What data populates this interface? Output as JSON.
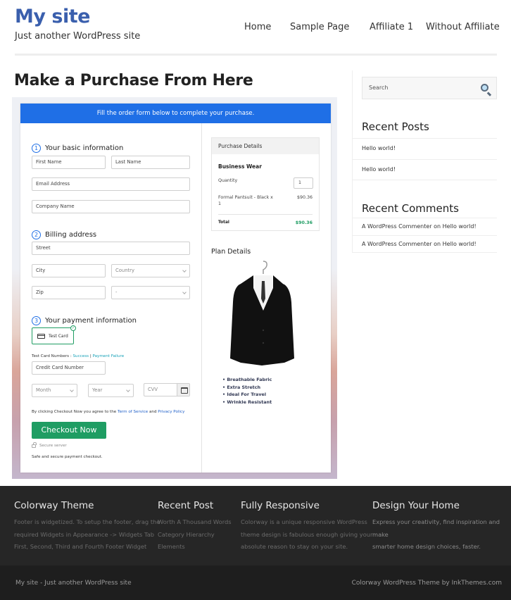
{
  "header": {
    "site_title": "My site",
    "tagline": "Just another WordPress site",
    "nav": [
      "Home",
      "Sample Page",
      "Affiliate 1",
      "Without Affiliate"
    ]
  },
  "page": {
    "title": "Make a Purchase From Here"
  },
  "checkout": {
    "banner": "Fill the order form below to complete your purchase.",
    "steps": [
      {
        "num": "1",
        "label": "Your basic information"
      },
      {
        "num": "2",
        "label": "Billing address"
      },
      {
        "num": "3",
        "label": "Your payment information"
      }
    ],
    "fields": {
      "first_name": "First Name",
      "last_name": "Last Name",
      "email": "Email Address",
      "company": "Company Name",
      "street": "Street",
      "city": "City",
      "country": "Country",
      "zip": "Zip",
      "state": "-",
      "card_number": "Credit Card Number",
      "month": "Month",
      "year": "Year",
      "cvv": "CVV"
    },
    "payment_option": "Test Card",
    "test_card_label": "Test Card Numbers :",
    "test_success": "Success",
    "test_separator": "|",
    "test_failure": "Payment Failure",
    "agree_prefix": "By clicking Checkout Now you agree to the",
    "terms_link": "Term of Service",
    "agree_and": "and",
    "privacy_link": "Privacy Policy",
    "checkout_button": "Checkout Now",
    "secure_server": "Secure server",
    "safe_text": "Safe and secure payment checkout.",
    "purchase": {
      "heading": "Purchase Details",
      "product": "Business Wear",
      "quantity_label": "Quantity",
      "quantity_value": "1",
      "line_item": "Formal Pantsuit - Black x",
      "line_item_qty": "1",
      "line_price": "$90.36",
      "total_label": "Total",
      "total_value": "$90.36",
      "total_color": "#1f9d63"
    },
    "plan": {
      "title": "Plan Details",
      "features": [
        "Breathable Fabric",
        "Extra Stretch",
        "Ideal For Travel",
        "Wrinkle Resistant"
      ]
    }
  },
  "sidebar": {
    "search_placeholder": "Search",
    "recent_posts_title": "Recent Posts",
    "recent_posts": [
      "Hello world!",
      "Hello world!"
    ],
    "recent_comments_title": "Recent Comments",
    "recent_comments": [
      "A WordPress Commenter on Hello world!",
      "A WordPress Commenter on Hello world!"
    ]
  },
  "footer": {
    "columns": [
      {
        "title": "Colorway Theme",
        "lines": [
          "Footer is widgetized. To setup the footer, drag the",
          "required Widgets in Appearance -> Widgets Tab",
          "First, Second, Third and Fourth Footer Widget"
        ]
      },
      {
        "title": "Recent Post",
        "lines": [
          "Worth A Thousand Words",
          "Category Hierarchy",
          "Elements"
        ]
      },
      {
        "title": "Fully Responsive",
        "lines": [
          "Colorway is a unique responsive WordPress",
          "theme design is fabulous enough giving your",
          "absolute reason to stay on your site."
        ]
      },
      {
        "title": "Design Your Home",
        "lines": [
          "Express your creativity, find inspiration and make",
          "smarter home design choices, faster."
        ]
      }
    ],
    "bottom_left": "My site - Just another WordPress site",
    "bottom_right": "Colorway WordPress Theme by InkThemes.com"
  },
  "colors": {
    "brand": "#3a5fad",
    "banner": "#1f6fe6",
    "checkout_green": "#1f9d63",
    "footer_bg": "#262626"
  }
}
